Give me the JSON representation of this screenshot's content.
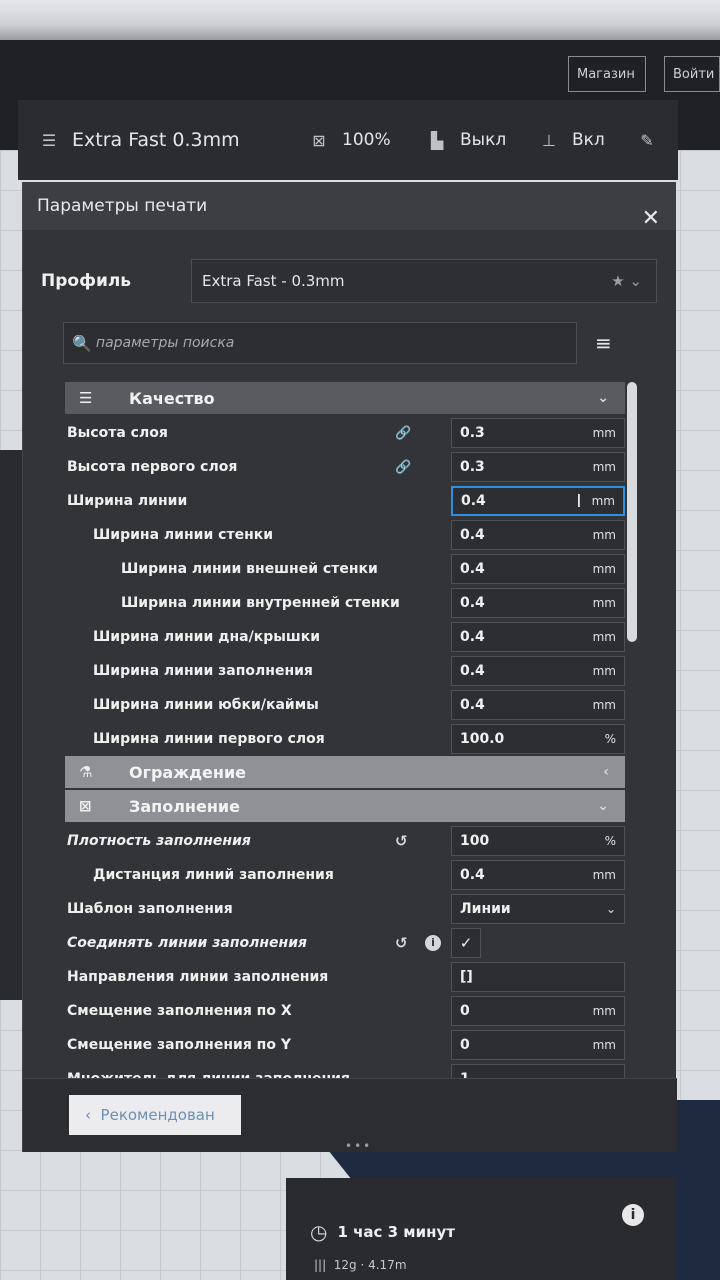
{
  "header": {
    "store_label": "Магазин",
    "login_label": "Войти"
  },
  "toolbar": {
    "profile": "Extra Fast 0.3mm",
    "infill": "100%",
    "support": "Выкл",
    "adhesion": "Вкл"
  },
  "panel": {
    "title": "Параметры печати",
    "profile_label": "Профиль",
    "profile_value": "Extra Fast - 0.3mm",
    "search_placeholder": "параметры поиска",
    "recommended_label": "Рекомендован"
  },
  "categories": {
    "quality": "Качество",
    "walls": "Ограждение",
    "infill": "Заполнение"
  },
  "quality_rows": [
    {
      "label": "Высота слоя",
      "value": "0.3",
      "unit": "mm"
    },
    {
      "label": "Высота первого слоя",
      "value": "0.3",
      "unit": "mm"
    },
    {
      "label": "Ширина линии",
      "value": "0.4",
      "unit": "mm"
    },
    {
      "label": "Ширина линии стенки",
      "value": "0.4",
      "unit": "mm"
    },
    {
      "label": "Ширина линии внешней стенки",
      "value": "0.4",
      "unit": "mm"
    },
    {
      "label": "Ширина линии внутренней стенки",
      "value": "0.4",
      "unit": "mm"
    },
    {
      "label": "Ширина линии дна/крышки",
      "value": "0.4",
      "unit": "mm"
    },
    {
      "label": "Ширина линии заполнения",
      "value": "0.4",
      "unit": "mm"
    },
    {
      "label": "Ширина линии юбки/каймы",
      "value": "0.4",
      "unit": "mm"
    },
    {
      "label": "Ширина линии первого слоя",
      "value": "100.0",
      "unit": "%"
    }
  ],
  "infill_rows": [
    {
      "label": "Плотность заполнения",
      "value": "100",
      "unit": "%"
    },
    {
      "label": "Дистанция линий заполнения",
      "value": "0.4",
      "unit": "mm"
    },
    {
      "label": "Шаблон заполнения",
      "value": "Линии"
    },
    {
      "label": "Соединять линии заполнения",
      "checked": "✓"
    },
    {
      "label": "Направления линии заполнения",
      "value": "[]"
    },
    {
      "label": "Смещение заполнения по X",
      "value": "0",
      "unit": "mm"
    },
    {
      "label": "Смещение заполнения по Y",
      "value": "0",
      "unit": "mm"
    },
    {
      "label": "Множитель для линии заполнения",
      "value": "1"
    }
  ],
  "estimate": {
    "time": "1 час 3 минут",
    "material": "12g · 4.17m"
  }
}
